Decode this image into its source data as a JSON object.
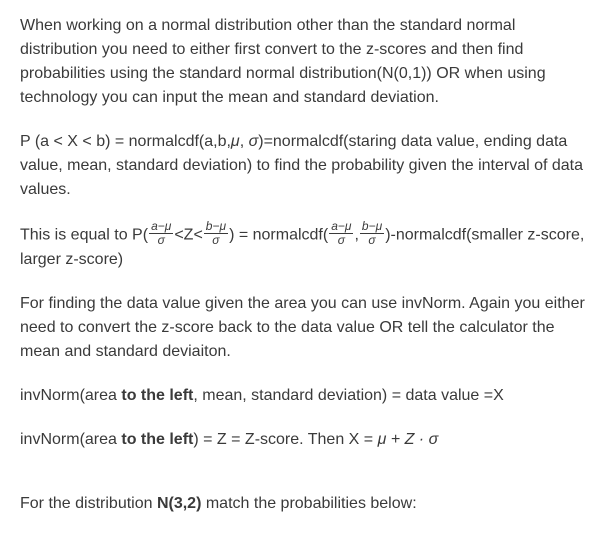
{
  "p1": "When working on a normal distribution other than the standard normal distribution you need to either first convert to the z-scores and then find probabilities using the standard normal distribution(N(0,1)) OR when using technology you can input the mean and standard deviation.",
  "p2_pre": "P (a < X < b) = normalcdf(a,b,",
  "p2_mu": "μ",
  "p2_mid": ", ",
  "p2_sigma": "σ",
  "p2_post": ")=normalcdf(staring data value, ending data value, mean, standard deviation) to find the probability given the interval of data values.",
  "p3_a": "This is equal to P(",
  "p3_frac1_num": "a−μ",
  "p3_frac1_den": "σ",
  "p3_b": "<Z<",
  "p3_frac2_num": "b−μ",
  "p3_frac2_den": "σ",
  "p3_c": ") = normalcdf(",
  "p3_frac3_num": "a−μ",
  "p3_frac3_den": "σ",
  "p3_d": ",",
  "p3_frac4_num": "b−μ",
  "p3_frac4_den": "σ",
  "p3_e": ")-normalcdf(smaller z-score, larger z-score)",
  "p4": "For finding the data value given the area you can use invNorm. Again you either need to convert the z-score back to the data value OR tell the calculator the mean and standard deviaiton.",
  "p5_a": "invNorm(area ",
  "p5_b": "to the left",
  "p5_c": ", mean, standard deviation) = data value =X",
  "p6_a": "invNorm(area ",
  "p6_b": "to the left",
  "p6_c": ") = Z = Z-score. Then X = ",
  "p6_d": "μ + Z · σ",
  "p7_a": "For the distribution ",
  "p7_b": "N(3,2)",
  "p7_c": " match the probabilities below:"
}
